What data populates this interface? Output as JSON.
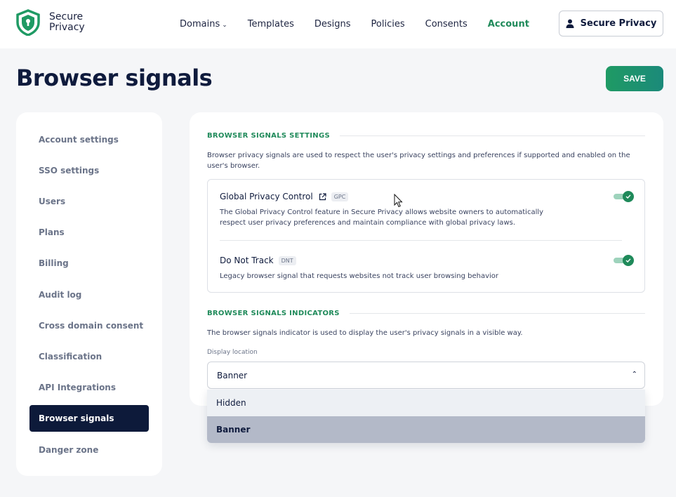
{
  "brand": {
    "line1": "Secure",
    "line2": "Privacy"
  },
  "nav": {
    "items": [
      {
        "label": "Domains",
        "has_dropdown": true
      },
      {
        "label": "Templates"
      },
      {
        "label": "Designs"
      },
      {
        "label": "Policies"
      },
      {
        "label": "Consents"
      },
      {
        "label": "Account",
        "active": true
      }
    ],
    "account_button": "Secure Privacy"
  },
  "page": {
    "title": "Browser signals",
    "save_label": "SAVE"
  },
  "sidebar": {
    "items": [
      {
        "label": "Account settings"
      },
      {
        "label": "SSO settings"
      },
      {
        "label": "Users"
      },
      {
        "label": "Plans"
      },
      {
        "label": "Billing"
      },
      {
        "label": "Audit log"
      },
      {
        "label": "Cross domain consent"
      },
      {
        "label": "Classification"
      },
      {
        "label": "API Integrations"
      },
      {
        "label": "Browser signals",
        "active": true
      },
      {
        "label": "Danger zone"
      }
    ]
  },
  "settings": {
    "heading": "BROWSER SIGNALS SETTINGS",
    "description": "Browser privacy signals are used to respect the user's privacy settings and preferences if supported and enabled on the user's browser.",
    "signals": [
      {
        "title": "Global Privacy Control",
        "badge": "GPC",
        "description": "The Global Privacy Control feature in Secure Privacy allows website owners to automatically respect user privacy preferences and maintain compliance with global privacy laws.",
        "enabled": true
      },
      {
        "title": "Do Not Track",
        "badge": "DNT",
        "description": "Legacy browser signal that requests websites not track user browsing behavior",
        "enabled": true
      }
    ]
  },
  "indicators": {
    "heading": "BROWSER SIGNALS INDICATORS",
    "description": "The browser signals indicator is used to display the user's privacy signals in a visible way.",
    "field_label": "Display location",
    "selected": "Banner",
    "options": [
      "Hidden",
      "Banner"
    ]
  },
  "colors": {
    "accent": "#1f8a5a",
    "navy": "#0d1a3a",
    "selected_option": "#b3b9c8"
  },
  "icons": {
    "logo": "shield-lock-icon",
    "account": "user-icon",
    "external_link": "external-link-icon",
    "toggle_check": "check-icon",
    "select_caret": "chevron-up-icon"
  }
}
